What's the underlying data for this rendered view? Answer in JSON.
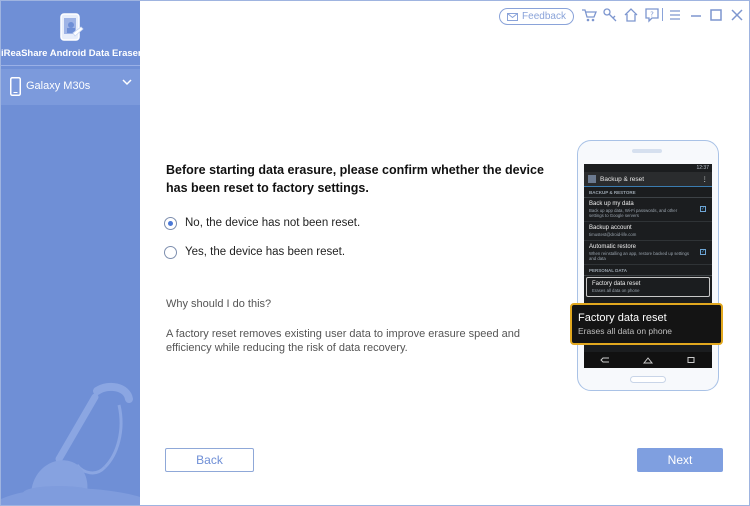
{
  "app": {
    "name": "iReaShare Android Data Eraser"
  },
  "sidebar": {
    "device_name": "Galaxy M30s"
  },
  "topbar": {
    "feedback_label": "Feedback",
    "icons": [
      "cart-icon",
      "key-icon",
      "home-icon",
      "help-icon",
      "menu-icon",
      "minimize-icon",
      "maximize-icon",
      "close-icon"
    ]
  },
  "main": {
    "question": "Before starting data erasure, please confirm whether the device has been reset to factory settings.",
    "options": [
      {
        "label": "No, the device has not been reset.",
        "selected": true
      },
      {
        "label": "Yes, the device has been reset.",
        "selected": false
      }
    ],
    "why_label": "Why should I do this?",
    "explanation": "A factory reset removes existing user data to improve erasure speed and efficiency while reducing the risk of data recovery."
  },
  "phone": {
    "status_time": "12:37",
    "screen_title": "Backup & reset",
    "section_backup": "BACKUP & RESTORE",
    "items": [
      {
        "title": "Back up my data",
        "sub": "Back up app data, Wi-Fi passwords, and other settings to Google servers",
        "checked": true
      },
      {
        "title": "Backup account",
        "sub": "timustest@droid-life.com",
        "checked": false
      },
      {
        "title": "Automatic restore",
        "sub": "When reinstalling an app, restore backed up settings and data",
        "checked": true
      }
    ],
    "section_personal": "PERSONAL DATA",
    "reset_item": {
      "title": "Factory data reset",
      "sub": "Erases all data on phone"
    }
  },
  "callout": {
    "title": "Factory data reset",
    "subtitle": "Erases all data on phone"
  },
  "buttons": {
    "back": "Back",
    "next": "Next"
  },
  "colors": {
    "sidebar": "#6f8fd6",
    "accent": "#7f9fe0",
    "callout_border": "#e2a81f"
  }
}
